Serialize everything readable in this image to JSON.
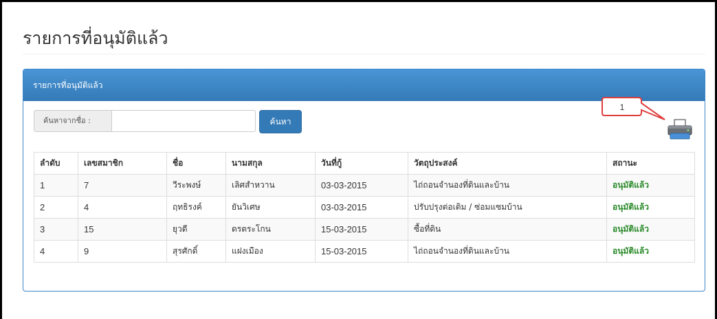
{
  "page": {
    "title": "รายการที่อนุมัติแล้ว"
  },
  "panel": {
    "heading": "รายการที่อนุมัติแล้ว"
  },
  "search": {
    "label": "ค้นหาจากชื่อ :",
    "value": "",
    "button_label": "ค้นหา"
  },
  "print": {
    "icon": "printer-icon"
  },
  "callout": {
    "label": "1",
    "color": "#e03c3c"
  },
  "table": {
    "headers": [
      "ลำดับ",
      "เลขสมาชิก",
      "ชื่อ",
      "นามสกุล",
      "วันที่กู้",
      "วัตถุประสงค์",
      "สถานะ"
    ],
    "rows": [
      [
        "1",
        "7",
        "วีระพงษ์",
        "เลิศสำหวาน",
        "03-03-2015",
        "ไถ่ถอนจำนองที่ดินและบ้าน",
        "อนุมัติแล้ว"
      ],
      [
        "2",
        "4",
        "ฤทธิรงค์",
        "ยันวิเศษ",
        "03-03-2015",
        "ปรับปรุงต่อเติม / ซ่อมแซมบ้าน",
        "อนุมัติแล้ว"
      ],
      [
        "3",
        "15",
        "ยุวดี",
        "ดรตระโกน",
        "15-03-2015",
        "ซื้อที่ดิน",
        "อนุมัติแล้ว"
      ],
      [
        "4",
        "9",
        "สุรศักดิ์",
        "แฝงเมือง",
        "15-03-2015",
        "ไถ่ถอนจำนองที่ดินและบ้าน",
        "อนุมัติแล้ว"
      ]
    ]
  },
  "colors": {
    "primary": "#337ab7",
    "status_approved": "#2a8a2a"
  }
}
